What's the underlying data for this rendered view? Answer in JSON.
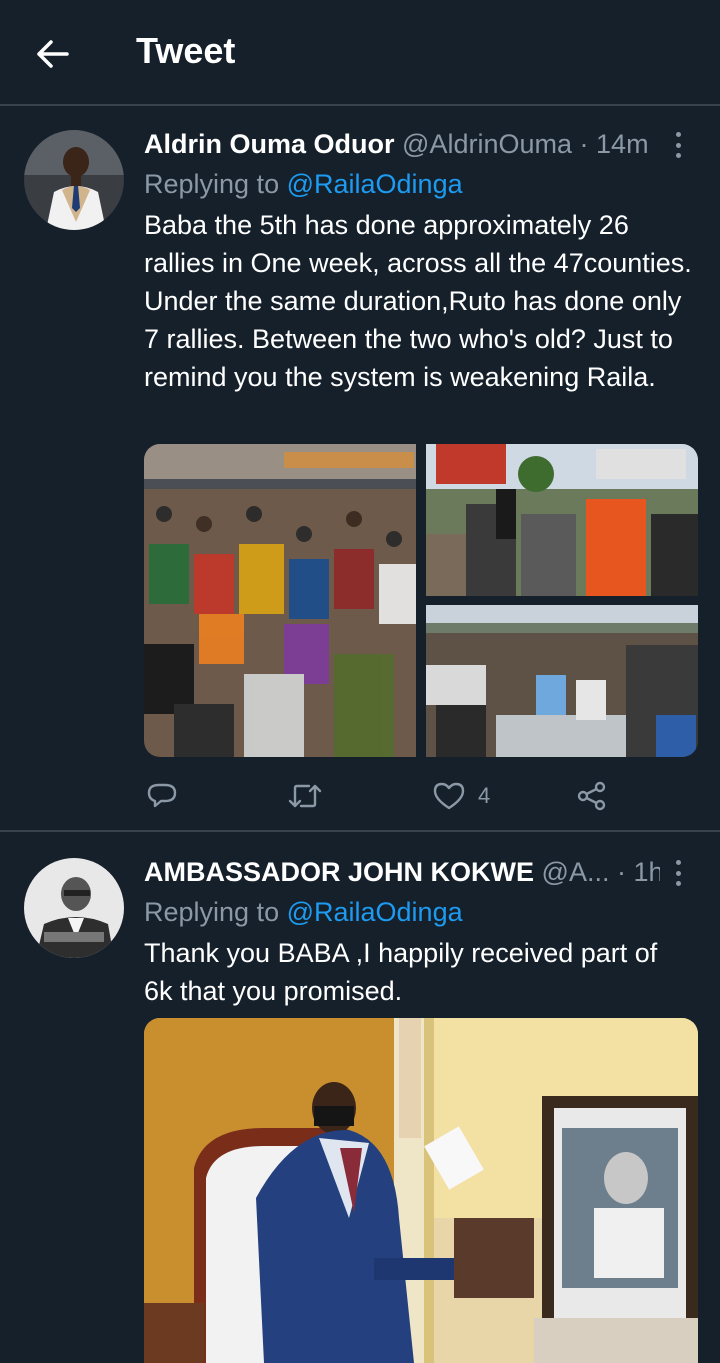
{
  "header": {
    "title": "Tweet"
  },
  "tweets": [
    {
      "name": "Aldrin Ouma Oduor",
      "handle": "@AldrinOuma",
      "separator": "·",
      "time": "14m",
      "replying_prefix": "Replying to ",
      "replying_to": "@RailaOdinga",
      "text": "Baba the 5th has done approximately 26 rallies in One week, across all the 47counties. Under the same duration,Ruto has done only 7 rallies. Between the two who's old? Just to remind you the system is weakening Raila.",
      "actions": {
        "reply_count": "",
        "retweet_count": "",
        "like_count": "4"
      }
    },
    {
      "name": "AMBASSADOR JOHN KOKWE",
      "handle": "@A...",
      "separator": "·",
      "time": "1h",
      "replying_prefix": "Replying to ",
      "replying_to": "@RailaOdinga",
      "text": "Thank you BABA ,I happily received part of 6k that you promised."
    }
  ],
  "colors": {
    "background": "#15202b",
    "divider": "#38444d",
    "secondary_text": "#8b98a5",
    "link": "#1d9bf0"
  },
  "icons": [
    "back-arrow-icon",
    "more-icon",
    "reply-icon",
    "retweet-icon",
    "like-icon",
    "share-icon"
  ]
}
